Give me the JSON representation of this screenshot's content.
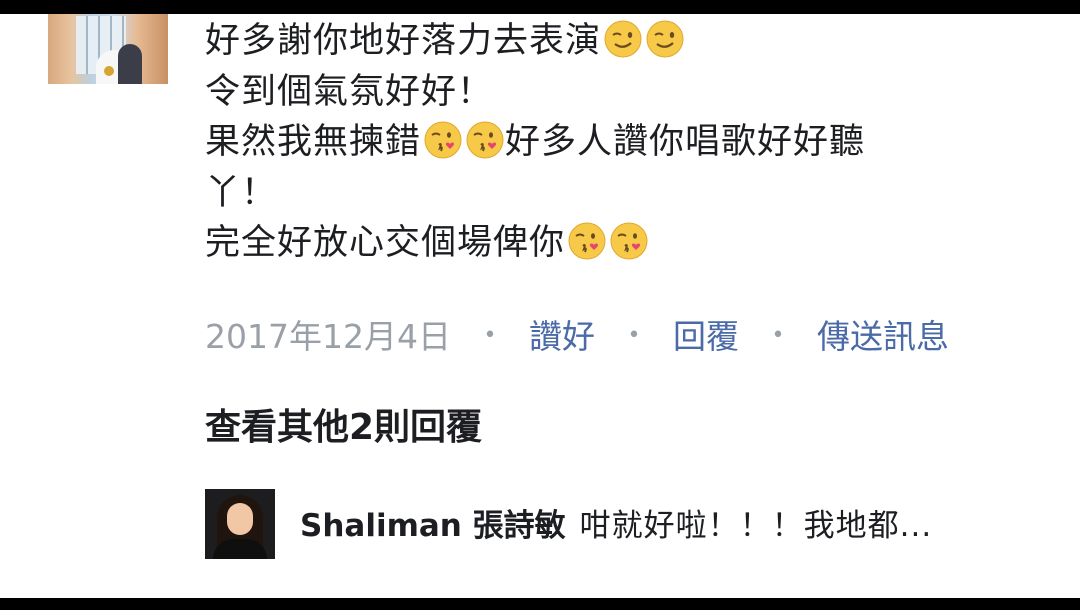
{
  "comment": {
    "lines": [
      {
        "text": "好多謝你地好落力去表演",
        "emojis": [
          "wink-emoji",
          "wink-emoji"
        ],
        "after": ""
      },
      {
        "text": "令到個氣氛好好！",
        "emojis": [],
        "after": ""
      },
      {
        "text": "果然我無揀錯",
        "emojis": [
          "kiss-emoji",
          "kiss-emoji"
        ],
        "after": "好多人讚你唱歌好好聽"
      },
      {
        "text": "丫！",
        "emojis": [],
        "after": ""
      },
      {
        "text": "完全好放心交個場俾你",
        "emojis": [
          "kiss-emoji",
          "kiss-emoji"
        ],
        "after": ""
      }
    ],
    "date": "2017年12月4日",
    "actions": {
      "like": "讚好",
      "reply": "回覆",
      "message": "傳送訊息"
    },
    "separator": "•"
  },
  "view_more": "查看其他2則回覆",
  "reply": {
    "name": "Shaliman 張詩敏",
    "snippet": "咁就好啦！！！我地都..."
  },
  "colors": {
    "text": "#1c1e21",
    "meta": "#9aa0a8",
    "link": "#4b6aa8",
    "emoji_face": "#f7c948"
  }
}
